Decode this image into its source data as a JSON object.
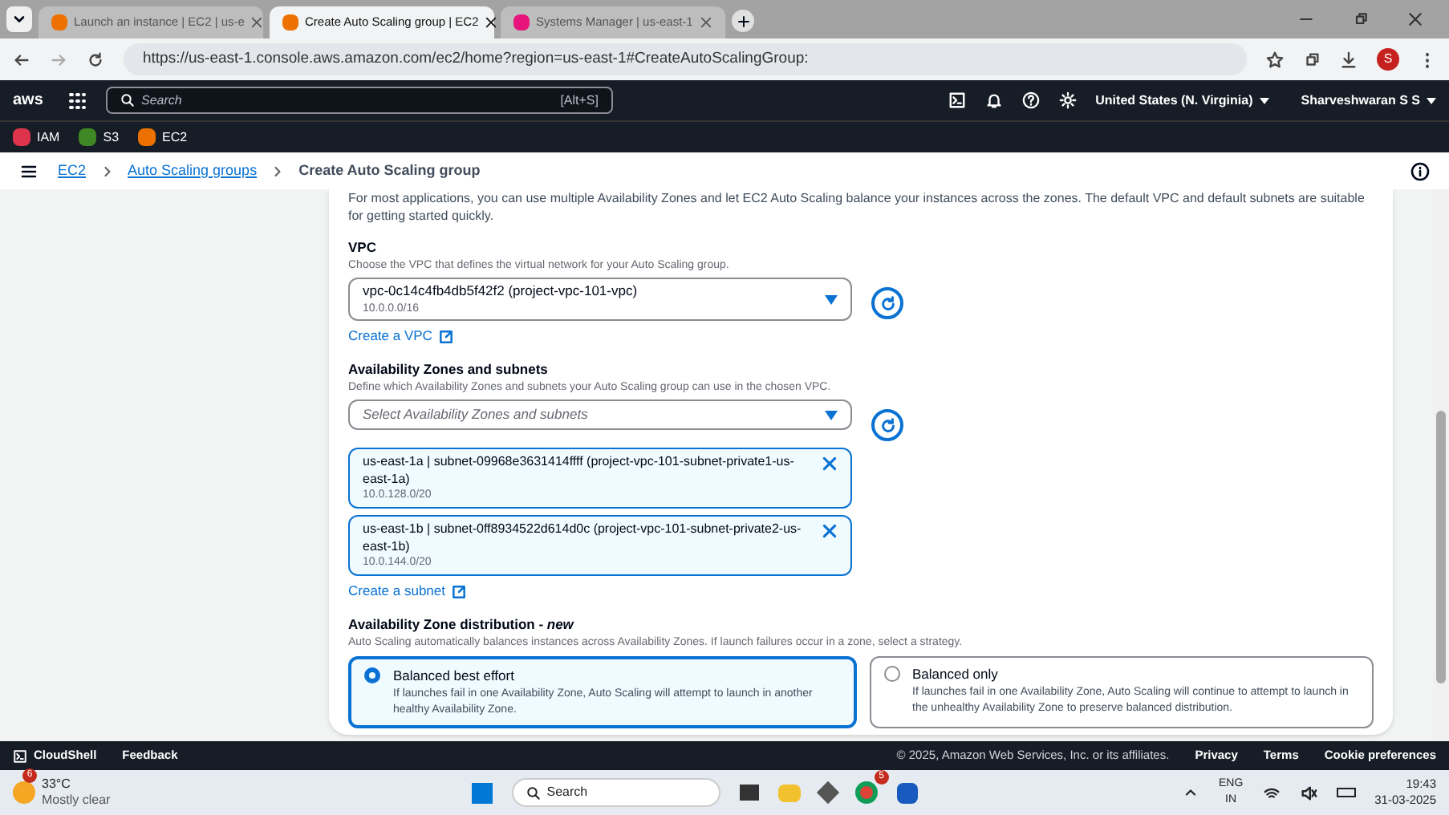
{
  "browser": {
    "tabs": [
      {
        "title": "Launch an instance | EC2 | us-e",
        "selected": false
      },
      {
        "title": "Create Auto Scaling group | EC2",
        "selected": true
      },
      {
        "title": "Systems Manager | us-east-1",
        "selected": false
      }
    ],
    "url": "https://us-east-1.console.aws.amazon.com/ec2/home?region=us-east-1#CreateAutoScalingGroup:",
    "profile": "S"
  },
  "console_nav": {
    "logo": "aws",
    "search_placeholder": "Search",
    "shortcut": "[Alt+S]",
    "region": "United States (N. Virginia)",
    "user": "Sharveshwaran S S"
  },
  "favorites": [
    {
      "label": "IAM",
      "color": "#dd344c"
    },
    {
      "label": "S3",
      "color": "#3f8624"
    },
    {
      "label": "EC2",
      "color": "#ed7100"
    }
  ],
  "breadcrumbs": [
    {
      "label": "EC2",
      "kind": "link"
    },
    {
      "label": "Auto Scaling groups",
      "kind": "link"
    },
    {
      "label": "Create Auto Scaling group",
      "kind": "current"
    }
  ],
  "intro": "For most applications, you can use multiple Availability Zones and let EC2 Auto Scaling balance your instances across the zones. The default VPC and default subnets are suitable for getting started quickly.",
  "vpc": {
    "label": "VPC",
    "description": "Choose the VPC that defines the virtual network for your Auto Scaling group.",
    "value": "vpc-0c14c4fb4db5f42f2 (project-vpc-101-vpc)",
    "detail": "10.0.0.0/16",
    "link": "Create a VPC"
  },
  "zones": {
    "label": "Availability Zones and subnets",
    "description": "Define which Availability Zones and subnets your Auto Scaling group can use in the chosen VPC.",
    "placeholder": "Select Availability Zones and subnets",
    "link": "Create a subnet",
    "selected_subnets": [
      {
        "name": "us-east-1a | subnet-09968e3631414ffff (project-vpc-101-subnet-private1-us-east-1a)",
        "cidr": "10.0.128.0/20"
      },
      {
        "name": "us-east-1b | subnet-0ff8934522d614d0c (project-vpc-101-subnet-private2-us-east-1b)",
        "cidr": "10.0.144.0/20"
      }
    ]
  },
  "distribution": {
    "label": "Availability Zone distribution - *new*",
    "description": "Auto Scaling automatically balances instances across Availability Zones. If launch failures occur in a zone, select a strategy.",
    "options": [
      {
        "label": "Balanced best effort",
        "description": "If launches fail in one Availability Zone, Auto Scaling will attempt to launch in another healthy Availability Zone.",
        "selected": true
      },
      {
        "label": "Balanced only",
        "description": "If launches fail in one Availability Zone, Auto Scaling will continue to attempt to launch in the unhealthy Availability Zone to preserve balanced distribution.",
        "selected": false
      }
    ]
  },
  "footer": {
    "cloudshell": "CloudShell",
    "feedback": "Feedback",
    "copyright": "© 2025, Amazon Web Services, Inc. or its affiliates.",
    "links": [
      "Privacy",
      "Terms",
      "Cookie preferences"
    ]
  },
  "taskbar": {
    "weather_badge": "6",
    "temperature": "33°C",
    "condition": "Mostly clear",
    "search": "Search",
    "chrome_badge": "5",
    "language": "ENG",
    "region": "IN",
    "time": "19:43",
    "date": "31-03-2025"
  }
}
